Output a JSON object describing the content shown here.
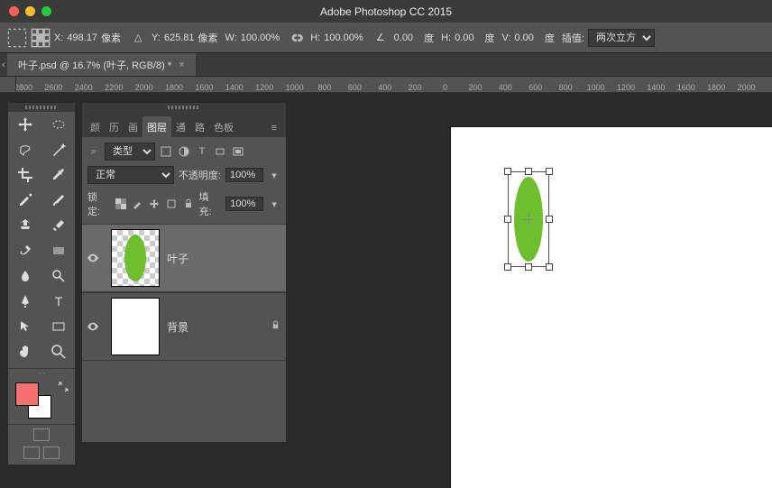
{
  "app": {
    "title": "Adobe Photoshop CC 2015"
  },
  "options": {
    "x_label": "X:",
    "x_value": "498.17",
    "x_unit": "像素",
    "y_label": "Y:",
    "y_value": "625.81",
    "y_unit": "像素",
    "w_label": "W:",
    "w_value": "100.00%",
    "h_label": "H:",
    "h_value": "100.00%",
    "angle_value": "0.00",
    "angle_unit": "度",
    "sh_label": "H:",
    "sh_value": "0.00",
    "sh_unit": "度",
    "sv_label": "V:",
    "sv_value": "0.00",
    "sv_unit": "度",
    "interp_label": "插值:",
    "interp_value": "两次立方"
  },
  "document": {
    "tab_label": "叶子.psd @ 16.7% (叶子, RGB/8) *"
  },
  "ruler_marks": [
    2800,
    2600,
    2400,
    2200,
    2000,
    1800,
    1600,
    1400,
    1200,
    1000,
    800,
    600,
    400,
    200,
    0,
    200,
    400,
    600,
    800,
    1000,
    1200,
    1400,
    1600,
    1800,
    2000
  ],
  "panel_tabs": {
    "tabs": [
      "颜",
      "历",
      "画",
      "图层",
      "通",
      "路",
      "色板"
    ],
    "active_index": 3
  },
  "layer_controls": {
    "filter_label": "类型",
    "search_icon": "⌕",
    "blend_mode": "正常",
    "opacity_label": "不透明度:",
    "opacity_value": "100%",
    "lock_label": "锁定:",
    "fill_label": "填充:",
    "fill_value": "100%"
  },
  "layers": [
    {
      "name": "叶子",
      "visible": true,
      "hasLeaf": true,
      "selected": true,
      "locked": false
    },
    {
      "name": "背景",
      "visible": true,
      "hasLeaf": false,
      "selected": false,
      "locked": true
    }
  ],
  "colors": {
    "accent_green": "#6DBF2E",
    "swatch_fg": "#f77070",
    "swatch_bg": "#ffffff"
  }
}
